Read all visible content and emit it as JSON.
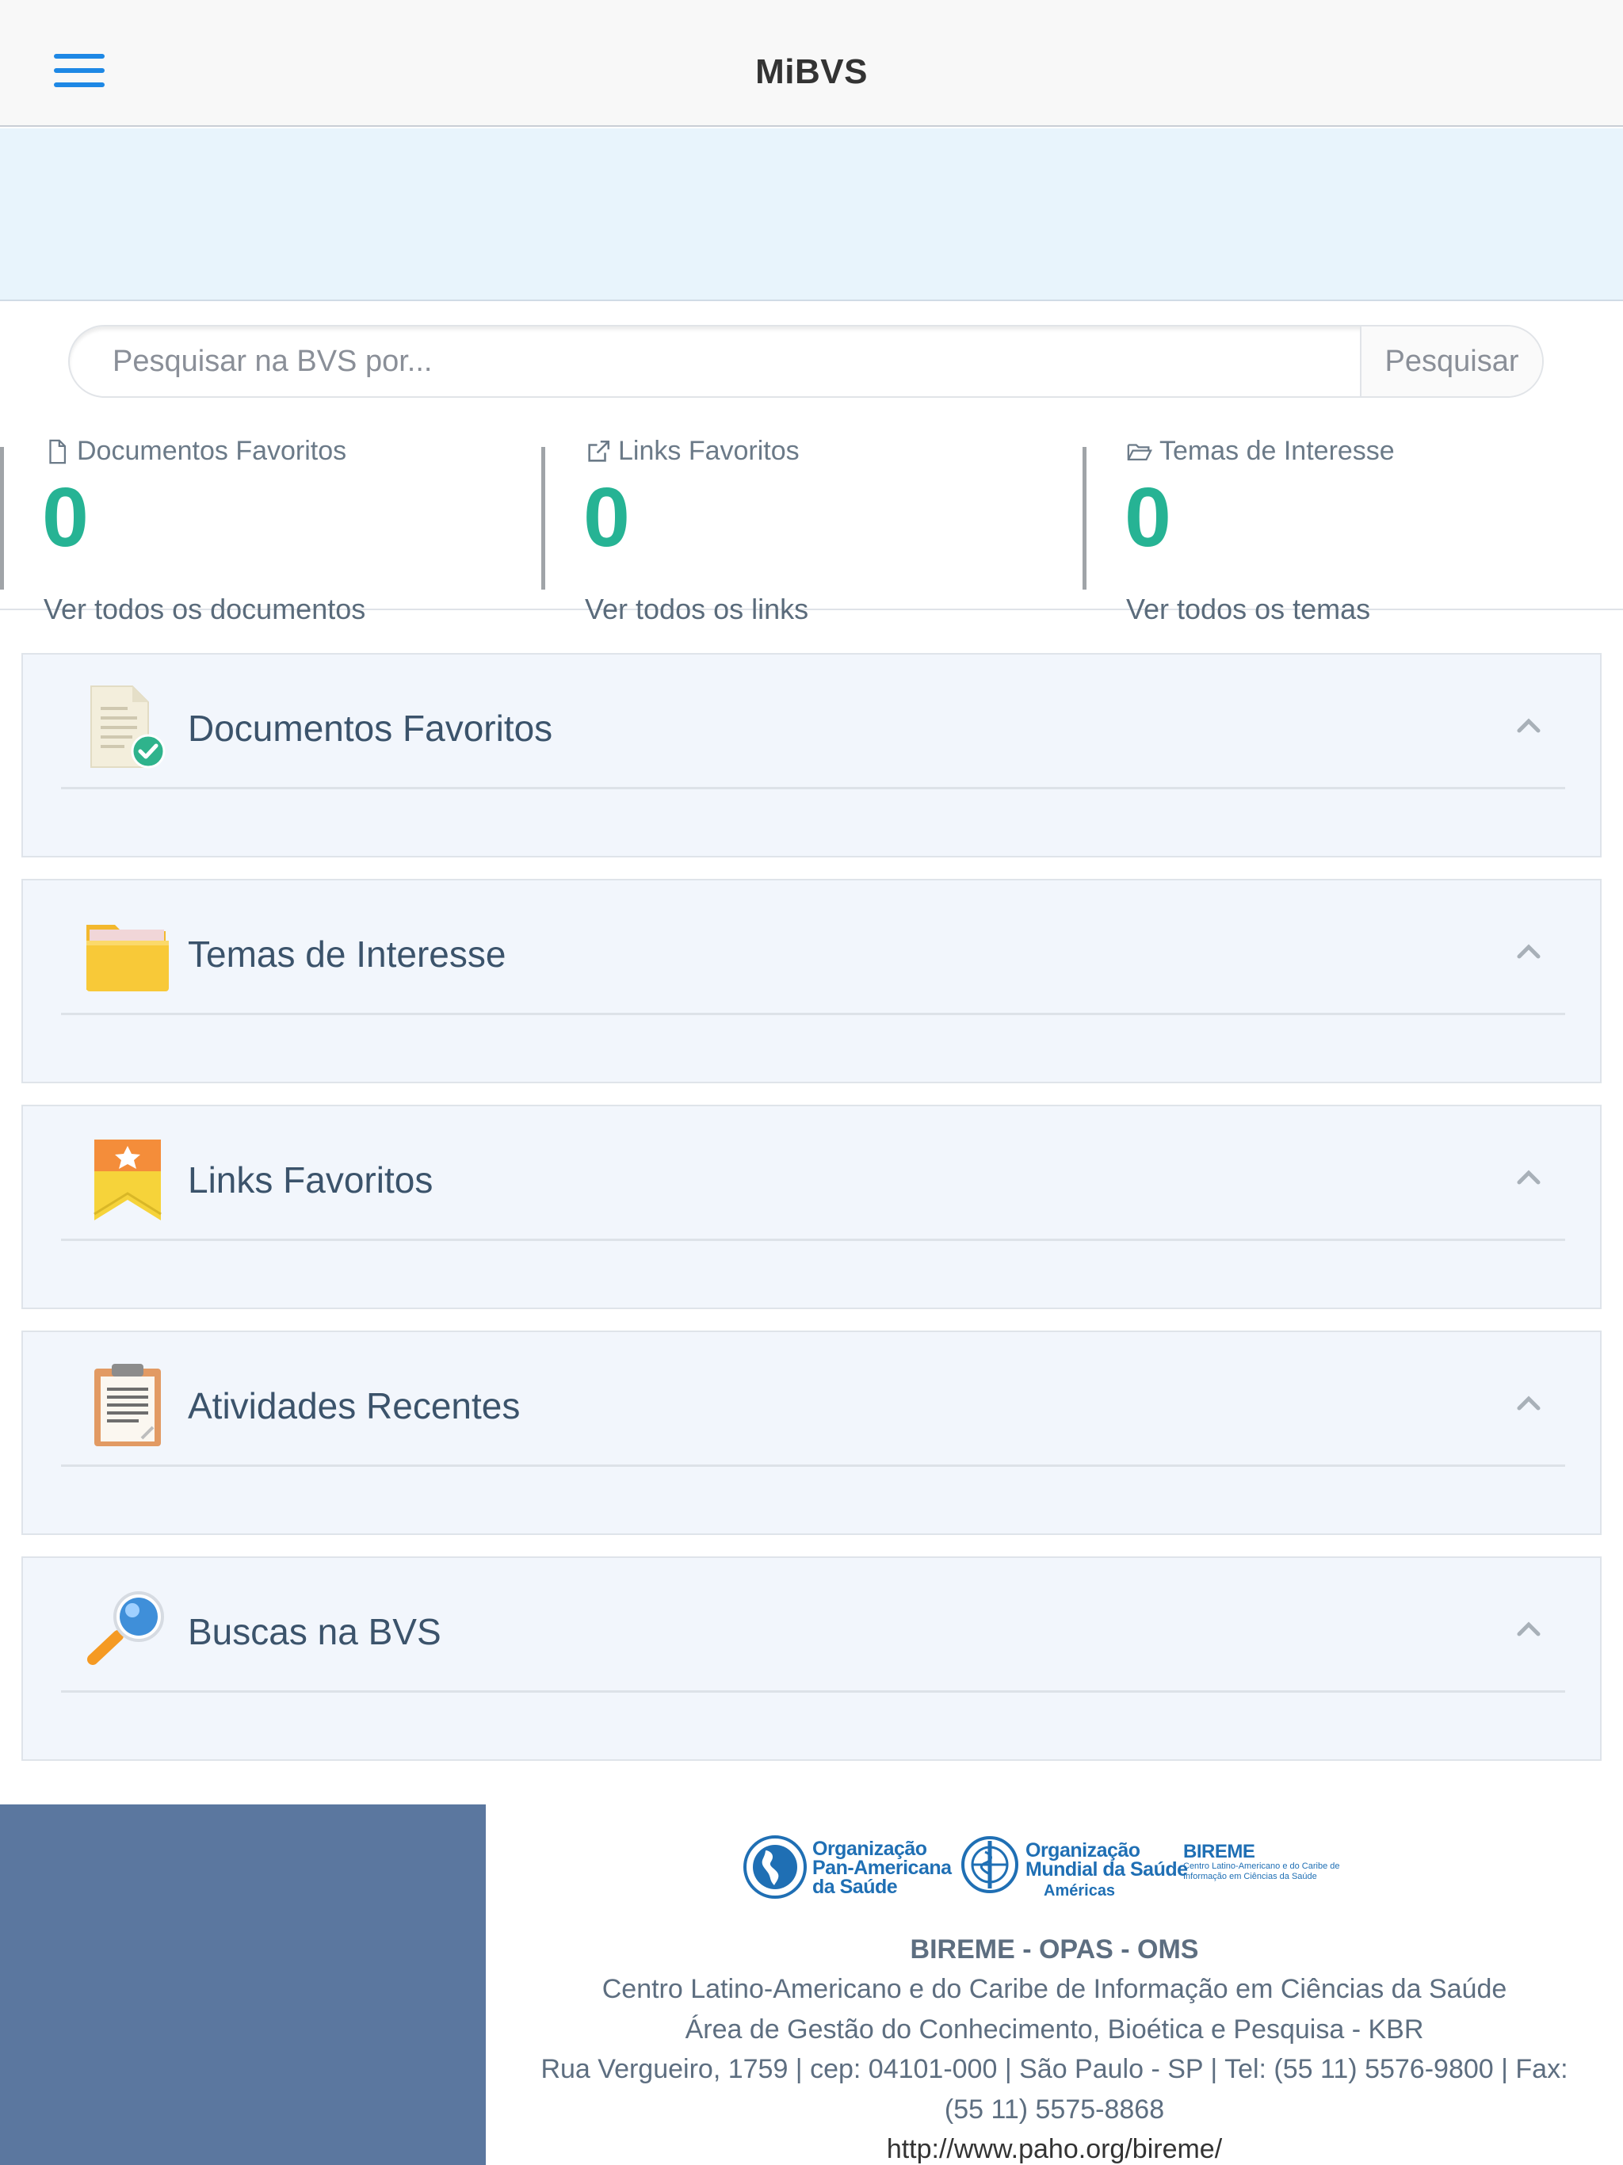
{
  "header": {
    "title": "MiBVS"
  },
  "search": {
    "placeholder": "Pesquisar na BVS por...",
    "button_label": "Pesquisar"
  },
  "stats": [
    {
      "label": "Documentos Favoritos",
      "count": "0",
      "link": "Ver todos os documentos",
      "icon": "file-icon"
    },
    {
      "label": "Links Favoritos",
      "count": "0",
      "link": "Ver todos os links",
      "icon": "external-link-icon"
    },
    {
      "label": "Temas de Interesse",
      "count": "0",
      "link": "Ver todos os temas",
      "icon": "folder-open-icon"
    }
  ],
  "panels": [
    {
      "title": "Documentos Favoritos",
      "icon": "document-check-icon"
    },
    {
      "title": "Temas de Interesse",
      "icon": "folder-icon"
    },
    {
      "title": "Links Favoritos",
      "icon": "bookmark-star-icon"
    },
    {
      "title": "Atividades Recentes",
      "icon": "clipboard-icon"
    },
    {
      "title": "Buscas na BVS",
      "icon": "magnifier-icon"
    }
  ],
  "footer": {
    "logos": {
      "paho": [
        "Organização",
        "Pan-Americana",
        "da Saúde"
      ],
      "oms": [
        "Organização",
        "Mundial da Saúde"
      ],
      "oms_region": "Américas",
      "bireme": "BIREME",
      "bireme_sub": [
        "Centro Latino-Americano e do Caribe de",
        "Informação em Ciências da Saúde"
      ]
    },
    "org": "BIREME - OPAS - OMS",
    "lines": [
      "Centro Latino-Americano e do Caribe de Informação em Ciências da Saúde",
      "Área de Gestão do Conhecimento, Bioética e Pesquisa - KBR",
      "Rua Vergueiro, 1759 | cep: 04101-000 | São Paulo - SP | Tel: (55 11) 5576-9800 | Fax:",
      "(55 11) 5575-8868"
    ],
    "url": "http://www.paho.org/bireme/"
  },
  "colors": {
    "accent": "#1e88e5",
    "count": "#26b394",
    "footer_block": "#5b779f",
    "banner": "#e8f4fc"
  }
}
